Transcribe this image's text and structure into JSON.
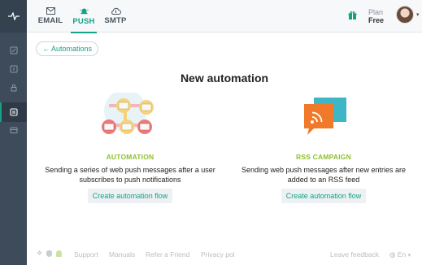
{
  "sidebar": {
    "logo": "pulse-logo",
    "items": [
      {
        "icon": "edit-icon",
        "active": false
      },
      {
        "icon": "form-icon",
        "active": false
      },
      {
        "icon": "lock-icon",
        "active": false
      },
      {
        "icon": "automation-icon",
        "active": true
      },
      {
        "icon": "wallet-icon",
        "active": false
      }
    ]
  },
  "header": {
    "tabs": [
      {
        "label": "EMAIL",
        "icon": "envelope-icon",
        "active": false
      },
      {
        "label": "PUSH",
        "icon": "bell-icon",
        "active": true
      },
      {
        "label": "SMTP",
        "icon": "cloud-icon",
        "active": false
      }
    ],
    "plan_label": "Plan",
    "plan_value": "Free",
    "gift_icon": "gift-icon"
  },
  "back_button": "← Automations",
  "title": "New automation",
  "cards": [
    {
      "title": "AUTOMATION",
      "desc_line1": "Sending a series of web push messages after a user",
      "desc_line2": "subscribes to push notifications",
      "button": "Create automation flow",
      "illustration": "automation-flow-illustration"
    },
    {
      "title": "RSS CAMPAIGN",
      "desc_line1": "Sending web push messages after new entries are",
      "desc_line2": "added to an RSS feed",
      "button": "Create automation flow",
      "illustration": "rss-illustration"
    }
  ],
  "footer": {
    "links": [
      "Support",
      "Manuals",
      "Refer a Friend",
      "Privacy pol"
    ],
    "feedback": "Leave feedback",
    "language": "En"
  },
  "colors": {
    "accent": "#16a085",
    "sidebar": "#3d4b5a",
    "card_title": "#8fbf2a",
    "rss_orange": "#f07a2a",
    "rss_teal": "#3fb6c6"
  }
}
